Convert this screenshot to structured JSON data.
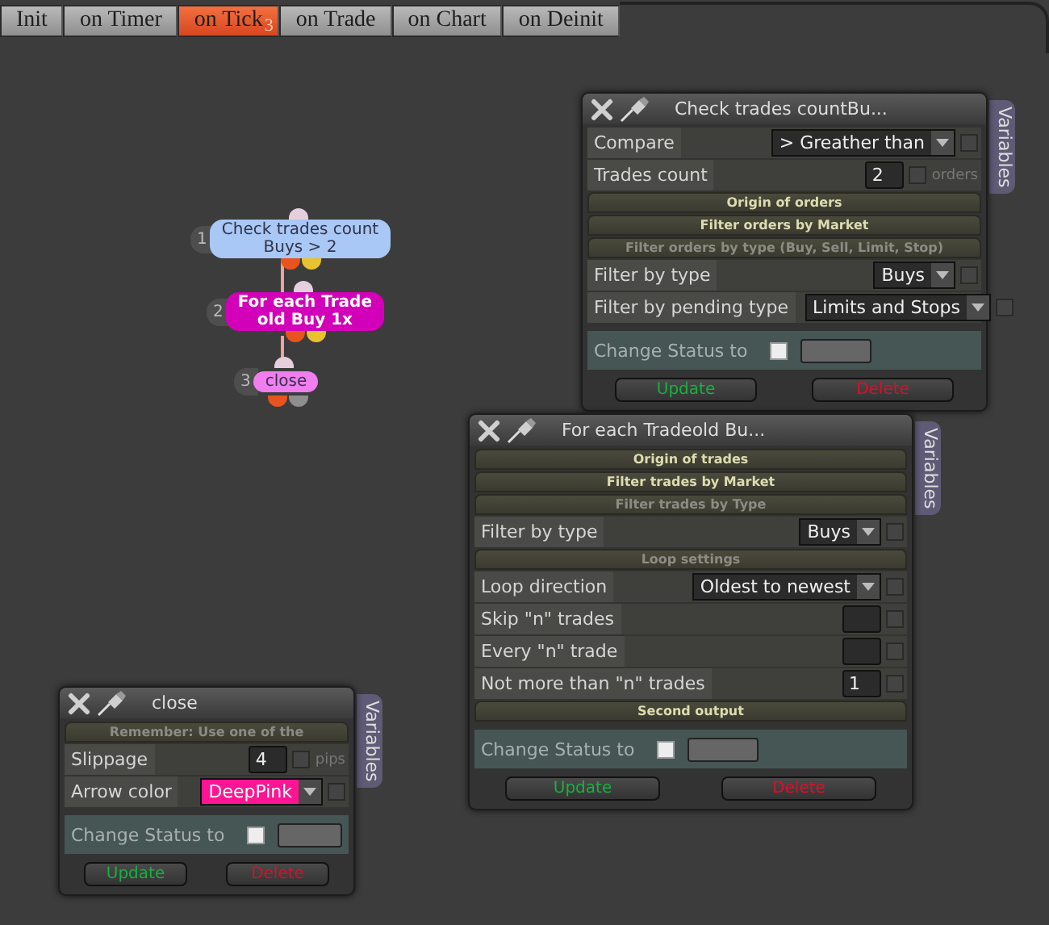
{
  "tabs": [
    {
      "label": "Init",
      "selected": false
    },
    {
      "label": "on Timer",
      "selected": false
    },
    {
      "label": "on Tick",
      "selected": true,
      "badge": "3"
    },
    {
      "label": "on Trade",
      "selected": false
    },
    {
      "label": "on Chart",
      "selected": false
    },
    {
      "label": "on Deinit",
      "selected": false
    }
  ],
  "nodes": [
    {
      "number": "1",
      "kind": "condition",
      "lines": [
        "Check trades count",
        "Buys > 2"
      ],
      "color": "#a9c8f5",
      "outputs": [
        {
          "color": "#e8531e"
        },
        {
          "color": "#e8c22f"
        }
      ]
    },
    {
      "number": "2",
      "kind": "loop",
      "lines": [
        "For each Trade",
        "old Buy 1x"
      ],
      "color": "#d300b9",
      "outputs": [
        {
          "color": "#e8531e"
        },
        {
          "color": "#e8c22f"
        }
      ]
    },
    {
      "number": "3",
      "kind": "action",
      "lines": [
        "close"
      ],
      "color": "#f07ef0",
      "outputs": [
        {
          "color": "#e8531e"
        },
        {
          "color": "#8e8e8e"
        }
      ]
    }
  ],
  "panels": [
    {
      "title": "Check trades countBu...",
      "side_tab": "Variables",
      "rows": [
        {
          "kind": "select",
          "label": "Compare",
          "value": "> Greather than",
          "checked": false
        },
        {
          "kind": "input",
          "label": "Trades count",
          "value": "2",
          "checked": false,
          "side_label": "orders"
        },
        {
          "kind": "header",
          "text": "Origin of orders",
          "dim": false
        },
        {
          "kind": "header",
          "text": "Filter orders by Market",
          "dim": false
        },
        {
          "kind": "header",
          "text": "Filter orders by type (Buy, Sell, Limit, Stop)",
          "dim": true
        },
        {
          "kind": "select",
          "label": "Filter by type",
          "value": "Buys",
          "checked": false
        },
        {
          "kind": "select",
          "label": "Filter by pending type",
          "value": "Limits and Stops",
          "checked": false
        }
      ],
      "status_label": "Change Status to",
      "status_checked": false,
      "update_label": "Update",
      "delete_label": "Delete"
    },
    {
      "title": "For each Tradeold Bu...",
      "side_tab": "Variables",
      "rows": [
        {
          "kind": "header",
          "text": "Origin of trades",
          "dim": false
        },
        {
          "kind": "header",
          "text": "Filter trades by Market",
          "dim": false
        },
        {
          "kind": "header",
          "text": "Filter trades by Type",
          "dim": true
        },
        {
          "kind": "select",
          "label": "Filter by type",
          "value": "Buys",
          "checked": false
        },
        {
          "kind": "header",
          "text": "Loop settings",
          "dim": true
        },
        {
          "kind": "select",
          "label": "Loop direction",
          "value": "Oldest to newest",
          "checked": false
        },
        {
          "kind": "input",
          "label": "Skip \"n\" trades",
          "checked": false
        },
        {
          "kind": "input",
          "label": "Every \"n\" trade",
          "checked": false
        },
        {
          "kind": "input",
          "label": "Not more than \"n\" trades",
          "value": "1",
          "checked": false
        },
        {
          "kind": "header",
          "text": "Second output",
          "dim": false
        }
      ],
      "status_label": "Change Status to",
      "status_checked": false,
      "update_label": "Update",
      "delete_label": "Delete"
    },
    {
      "title": "close",
      "side_tab": "Variables",
      "rows": [
        {
          "kind": "header",
          "text": "Remember: Use one of the",
          "dim": true
        },
        {
          "kind": "input",
          "label": "Slippage",
          "value": "4",
          "checked": false,
          "side_label": "pips"
        },
        {
          "kind": "color",
          "label": "Arrow color",
          "value": "DeepPink",
          "color": "#ff1493",
          "checked": false
        }
      ],
      "status_label": "Change Status to",
      "status_checked": false,
      "update_label": "Update",
      "delete_label": "Delete"
    }
  ]
}
